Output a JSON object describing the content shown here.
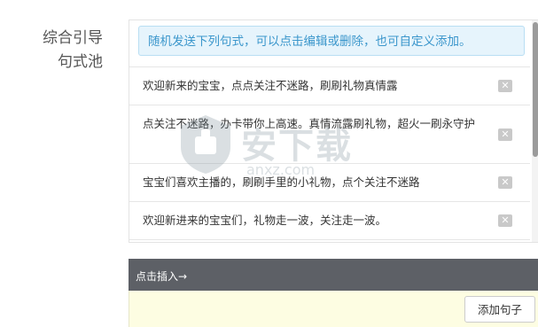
{
  "section": {
    "label_line1": "综合引导",
    "label_line2": "句式池"
  },
  "hint": "随机发送下列句式，可以点击编辑或删除，也可自定义添加。",
  "items": [
    {
      "text": "欢迎新来的宝宝，点点关注不迷路，刷刷礼物真情露",
      "delete_icon": "close-icon"
    },
    {
      "text": "点关注不迷路，办卡带你上高速。真情流露刷礼物，超火一刷永守护",
      "delete_icon": "close-icon"
    },
    {
      "text": "宝宝们喜欢主播的，刷刷手里的小礼物，点个关注不迷路",
      "delete_icon": "close-icon"
    },
    {
      "text": "欢迎新进来的宝宝们，礼物走一波，关注走一波。",
      "delete_icon": "close-icon"
    }
  ],
  "insert_bar": "点击插入→",
  "add_button": "添加句子",
  "input_value": "",
  "watermark": {
    "logo_text": "安下载",
    "sub_text": "anxz.com"
  },
  "colors": {
    "hint_text": "#3c97cc",
    "hint_bg": "#e6f4fc",
    "insert_bar_bg": "#5d6066",
    "input_bg": "#fdfde2"
  }
}
